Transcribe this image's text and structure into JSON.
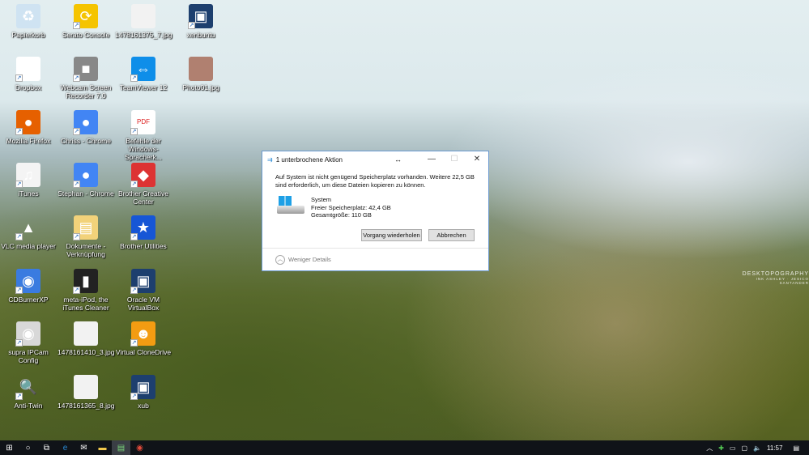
{
  "desktop": {
    "icons": [
      {
        "label": "Papierkorb",
        "icon": "recycle-bin-icon",
        "color": "#cfe3f2",
        "glyph": "♻"
      },
      {
        "label": "Dropbox",
        "icon": "dropbox-icon",
        "color": "#ffffff",
        "glyph": "◆"
      },
      {
        "label": "Mozilla Firefox",
        "icon": "firefox-icon",
        "color": "#e66000",
        "glyph": "●"
      },
      {
        "label": "iTunes",
        "icon": "itunes-icon",
        "color": "#f4f4f4",
        "glyph": "♫"
      },
      {
        "label": "VLC media player",
        "icon": "vlc-icon",
        "color": "transparent",
        "glyph": "▲"
      },
      {
        "label": "CDBurnerXP",
        "icon": "cdburner-icon",
        "color": "#3a7be0",
        "glyph": "◉"
      },
      {
        "label": "supra IPCam Config",
        "icon": "webcam-icon",
        "color": "#d8d8d8",
        "glyph": "◉"
      },
      {
        "label": "Anti-Twin",
        "icon": "magnifier-icon",
        "color": "transparent",
        "glyph": "🔍"
      },
      {
        "label": "Serato Console",
        "icon": "serato-icon",
        "color": "#f5c400",
        "glyph": "⟳"
      },
      {
        "label": "Webcam Screen Recorder 7.0",
        "icon": "camcorder-icon",
        "color": "#888",
        "glyph": "■"
      },
      {
        "label": "Chriss - Chrome",
        "icon": "chrome-icon",
        "color": "#4285f4",
        "glyph": "●"
      },
      {
        "label": "Stephan - Chrome",
        "icon": "chrome-icon",
        "color": "#4285f4",
        "glyph": "●"
      },
      {
        "label": "Dokumente - Verknüpfung",
        "icon": "folder-icon",
        "color": "#f2d27a",
        "glyph": "▤"
      },
      {
        "label": "meta-iPod, the iTunes Cleaner",
        "icon": "ipod-icon",
        "color": "#222",
        "glyph": "▮"
      },
      {
        "label": "1478161410_3.jpg",
        "icon": "image-file-icon",
        "color": "#f2f2f2",
        "glyph": ""
      },
      {
        "label": "1478161365_8.jpg",
        "icon": "image-file-icon",
        "color": "#f2f2f2",
        "glyph": ""
      },
      {
        "label": "1478161375_7.jpg",
        "icon": "image-file-icon",
        "color": "#f2f2f2",
        "glyph": ""
      },
      {
        "label": "TeamViewer 12",
        "icon": "teamviewer-icon",
        "color": "#0e8ee9",
        "glyph": "⇔"
      },
      {
        "label": "Befehle der Windows-Spracherk...",
        "icon": "pdf-icon",
        "color": "#fff",
        "glyph": "PDF"
      },
      {
        "label": "Brother Creative Center",
        "icon": "brother-creative-icon",
        "color": "#d33",
        "glyph": "◆"
      },
      {
        "label": "Brother Utilities",
        "icon": "brother-utilities-icon",
        "color": "#1656d6",
        "glyph": "★"
      },
      {
        "label": "Oracle VM VirtualBox",
        "icon": "virtualbox-icon",
        "color": "#1d3f6e",
        "glyph": "▣"
      },
      {
        "label": "Virtual CloneDrive",
        "icon": "clonedrive-icon",
        "color": "#f39c12",
        "glyph": "☻"
      },
      {
        "label": "xub",
        "icon": "virtualbox-icon",
        "color": "#1d3f6e",
        "glyph": "▣"
      },
      {
        "label": "xenbuntu",
        "icon": "virtualbox-icon",
        "color": "#1d3f6e",
        "glyph": "▣"
      },
      {
        "label": "Photo01.jpg",
        "icon": "image-file-icon",
        "color": "#b08070",
        "glyph": ""
      }
    ]
  },
  "dialog": {
    "title": "1 unterbrochene Aktion",
    "message": "Auf System ist nicht genügend Speicherplatz vorhanden. Weitere 22,5 GB sind erforderlich, um diese Dateien kopieren zu können.",
    "drive_name": "System",
    "free_space": "Freier Speicherplatz: 42,4 GB",
    "total_size": "Gesamtgröße: 110 GB",
    "retry_label": "Vorgang wiederholen",
    "cancel_label": "Abbrechen",
    "details_label": "Weniger Details"
  },
  "wallpaper": {
    "brand": "DESKTOPOGRAPHY",
    "credit": "INK ASHLEY · JESICO SANTANDER"
  },
  "taskbar": {
    "time": "11:57"
  }
}
